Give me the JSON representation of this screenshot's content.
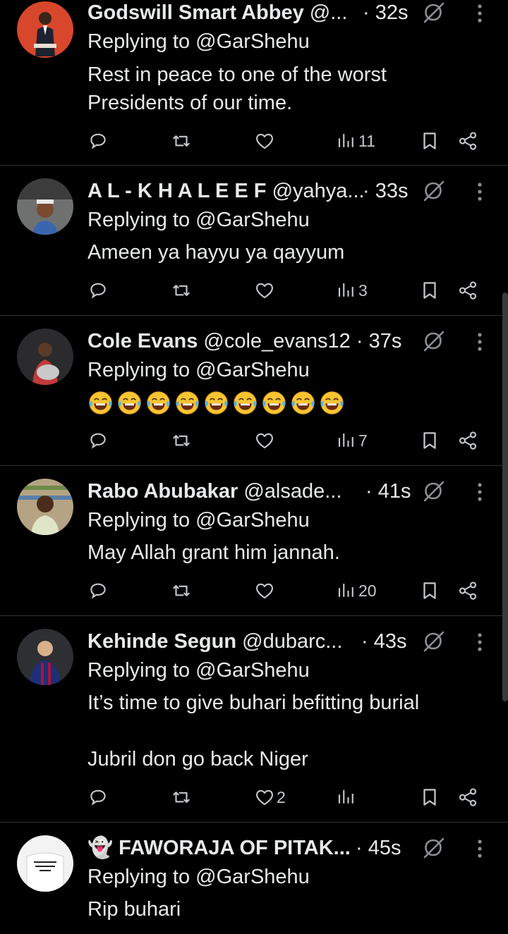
{
  "colors": {
    "background": "#000000",
    "text": "#e7e9ea",
    "divider": "#2f3336",
    "icon": "#c4c8cc"
  },
  "replies": [
    {
      "name": "Godswill Smart Abbey",
      "handle": "@...",
      "time": "· 32s",
      "replying_prefix": "Replying to",
      "replying_to": "@GarShehu",
      "text": "Rest in peace to one of the worst Presidents of our time.",
      "likes": "",
      "views": "11"
    },
    {
      "name": "A L - K H A L E E F",
      "handle": "@yahya...",
      "time": "· 33s",
      "replying_prefix": "Replying to",
      "replying_to": "@GarShehu",
      "text": "Ameen ya hayyu ya qayyum",
      "likes": "",
      "views": "3"
    },
    {
      "name": "Cole Evans",
      "handle": "@cole_evans12",
      "time": "· 37s",
      "replying_prefix": "Replying to",
      "replying_to": "@GarShehu",
      "emoji": [
        "😂",
        "😂",
        "😂",
        "😂",
        "😂",
        "😂",
        "😂",
        "😂",
        "😂"
      ],
      "likes": "",
      "views": "7"
    },
    {
      "name": "Rabo Abubakar",
      "handle": "@alsade...",
      "time": "· 41s",
      "replying_prefix": "Replying to",
      "replying_to": "@GarShehu",
      "text": "May Allah grant him jannah.",
      "likes": "",
      "views": "20"
    },
    {
      "name": "Kehinde Segun",
      "handle": "@dubarc...",
      "time": "· 43s",
      "replying_prefix": "Replying to",
      "replying_to": "@GarShehu",
      "text": "It’s time to give buhari befitting burial\n\nJubril don go back Niger",
      "likes": "2",
      "views": ""
    },
    {
      "name": "👻 FAWORAJA OF PITAK...",
      "handle": "",
      "time": "· 45s",
      "replying_prefix": "Replying to",
      "replying_to": "@GarShehu",
      "text": "Rip buhari",
      "likes": "",
      "views": ""
    }
  ],
  "icons": {
    "reply": "reply-icon",
    "retweet": "retweet-icon",
    "like": "heart-icon",
    "views": "views-icon",
    "bookmark": "bookmark-icon",
    "share": "share-icon",
    "mute": "muted-conversation-icon",
    "more": "more-icon"
  }
}
